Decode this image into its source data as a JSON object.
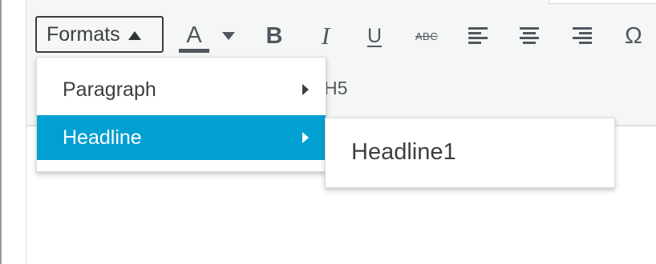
{
  "toolbar": {
    "formats_label": "Formats",
    "font_color_letter": "A",
    "bold_label": "B",
    "italic_label": "I",
    "underline_label": "U",
    "strikethrough_label": "ABC",
    "special_char_label": "Ω",
    "behind_menu_text": "H5"
  },
  "formats_menu": {
    "items": [
      {
        "label": "Paragraph",
        "selected": false
      },
      {
        "label": "Headline",
        "selected": true
      }
    ]
  },
  "headline_submenu": {
    "items": [
      {
        "label": "Headline1"
      }
    ]
  },
  "colors": {
    "highlight": "#00a0d2",
    "toolbar_bg": "#f5f6f6",
    "icon": "#50575e",
    "text": "#3b3f42"
  },
  "icons": [
    "caret-up-icon",
    "font-color-icon",
    "caret-down-icon",
    "bold-icon",
    "italic-icon",
    "underline-icon",
    "strikethrough-icon",
    "align-left-icon",
    "align-center-icon",
    "align-right-icon",
    "special-character-icon",
    "chevron-right-icon"
  ]
}
